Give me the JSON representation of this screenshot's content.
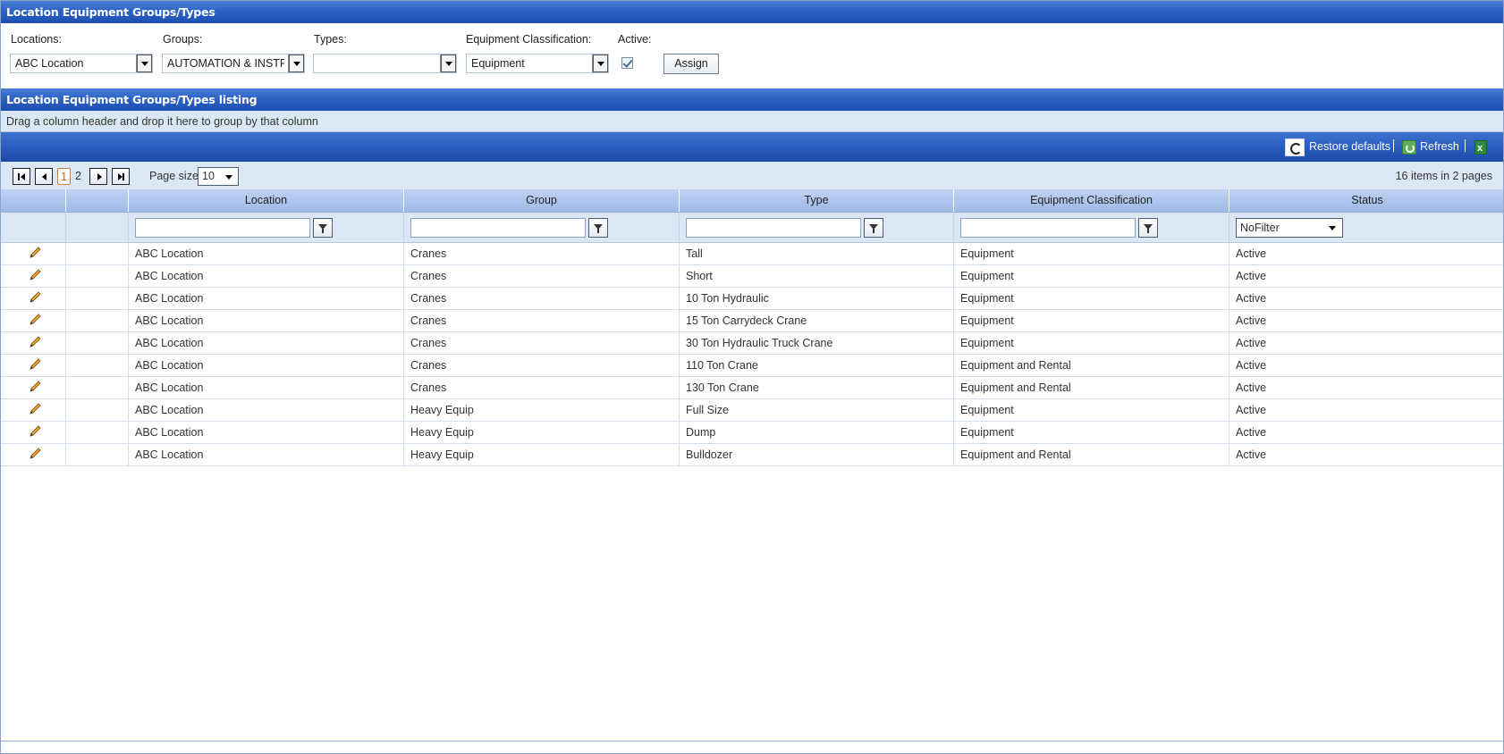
{
  "title": "Location Equipment Groups/Types",
  "form": {
    "locations_label": "Locations:",
    "locations_value": "ABC Location",
    "groups_label": "Groups:",
    "groups_value": "AUTOMATION & INSTRU",
    "types_label": "Types:",
    "types_value": "",
    "classification_label": "Equipment Classification:",
    "classification_value": "Equipment",
    "active_label": "Active:",
    "active_checked": true,
    "assign_label": "Assign"
  },
  "listing_title": "Location Equipment Groups/Types listing",
  "group_panel_text": "Drag a column header and drop it here to group by that column",
  "commands": {
    "restore_defaults": "Restore defaults",
    "refresh": "Refresh",
    "separator": "|"
  },
  "pager": {
    "pages": [
      "1",
      "2"
    ],
    "current_page": "1",
    "page_size_label": "Page size:",
    "page_size": "10",
    "items_info": "16 items in 2 pages"
  },
  "columns": [
    "Location",
    "Group",
    "Type",
    "Equipment Classification",
    "Status"
  ],
  "status_filter": "NoFilter",
  "delete_glyph": "✕",
  "rows": [
    {
      "location": "ABC Location",
      "group": "Cranes",
      "type": "Tall",
      "classification": "Equipment",
      "status": "Active"
    },
    {
      "location": "ABC Location",
      "group": "Cranes",
      "type": "Short",
      "classification": "Equipment",
      "status": "Active"
    },
    {
      "location": "ABC Location",
      "group": "Cranes",
      "type": "10 Ton Hydraulic",
      "classification": "Equipment",
      "status": "Active"
    },
    {
      "location": "ABC Location",
      "group": "Cranes",
      "type": "15 Ton Carrydeck Crane",
      "classification": "Equipment",
      "status": "Active"
    },
    {
      "location": "ABC Location",
      "group": "Cranes",
      "type": "30 Ton Hydraulic Truck Crane",
      "classification": "Equipment",
      "status": "Active"
    },
    {
      "location": "ABC Location",
      "group": "Cranes",
      "type": "110 Ton Crane",
      "classification": "Equipment and Rental",
      "status": "Active"
    },
    {
      "location": "ABC Location",
      "group": "Cranes",
      "type": "130 Ton Crane",
      "classification": "Equipment and Rental",
      "status": "Active"
    },
    {
      "location": "ABC Location",
      "group": "Heavy Equip",
      "type": "Full Size",
      "classification": "Equipment",
      "status": "Active"
    },
    {
      "location": "ABC Location",
      "group": "Heavy Equip",
      "type": "Dump",
      "classification": "Equipment",
      "status": "Active"
    },
    {
      "location": "ABC Location",
      "group": "Heavy Equip",
      "type": "Bulldozer",
      "classification": "Equipment and Rental",
      "status": "Active"
    }
  ],
  "colors": {
    "header_blue": "#2c62c4",
    "panel_light": "#dbe7f5",
    "delete_red": "#d9262d",
    "current_page": "#c46a1e"
  }
}
